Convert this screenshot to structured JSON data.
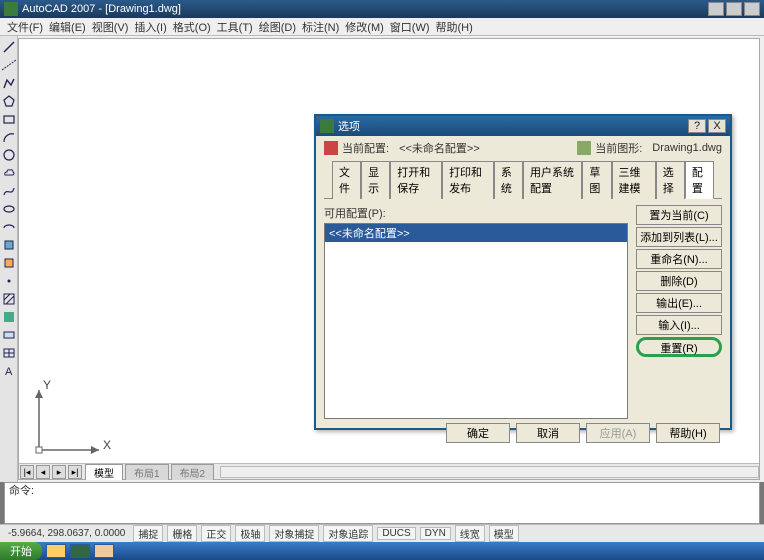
{
  "titlebar": {
    "text": "AutoCAD 2007 - [Drawing1.dwg]"
  },
  "menu": {
    "file": "文件(F)",
    "edit": "编辑(E)",
    "view": "视图(V)",
    "insert": "插入(I)",
    "format": "格式(O)",
    "tools": "工具(T)",
    "draw": "绘图(D)",
    "dimension": "标注(N)",
    "modify": "修改(M)",
    "window": "窗口(W)",
    "help": "帮助(H)"
  },
  "ucs": {
    "x": "X",
    "y": "Y"
  },
  "drawtabs": {
    "model": "模型",
    "layout1": "布局1",
    "layout2": "布局2"
  },
  "command": {
    "prompt": "命令:"
  },
  "status": {
    "coords": "-5.9664, 298.0637, 0.0000",
    "snap": "捕捉",
    "grid": "栅格",
    "ortho": "正交",
    "polar": "极轴",
    "osnap": "对象捕捉",
    "otrack": "对象追踪",
    "ducs": "DUCS",
    "dyn": "DYN",
    "lwt": "线宽",
    "model": "模型"
  },
  "taskbar": {
    "start": "开始"
  },
  "dialog": {
    "title": "选项",
    "help_btn": "?",
    "close_btn": "X",
    "cur_profile_label": "当前配置:",
    "cur_profile_value": "<<未命名配置>>",
    "cur_drawing_label": "当前图形:",
    "cur_drawing_value": "Drawing1.dwg",
    "tabs": {
      "file": "文件",
      "display": "显示",
      "opensave": "打开和保存",
      "plot": "打印和发布",
      "system": "系统",
      "userpref": "用户系统配置",
      "draft": "草图",
      "3dmodel": "三维建模",
      "select": "选择",
      "profile": "配置"
    },
    "list_label": "可用配置(P):",
    "list_item": "<<未命名配置>>",
    "btns": {
      "setcur": "置为当前(C)",
      "addlist": "添加到列表(L)...",
      "rename": "重命名(N)...",
      "delete": "删除(D)",
      "export": "输出(E)...",
      "import": "输入(I)...",
      "reset": "重置(R)"
    },
    "foot": {
      "ok": "确定",
      "cancel": "取消",
      "apply": "应用(A)",
      "help": "帮助(H)"
    }
  }
}
